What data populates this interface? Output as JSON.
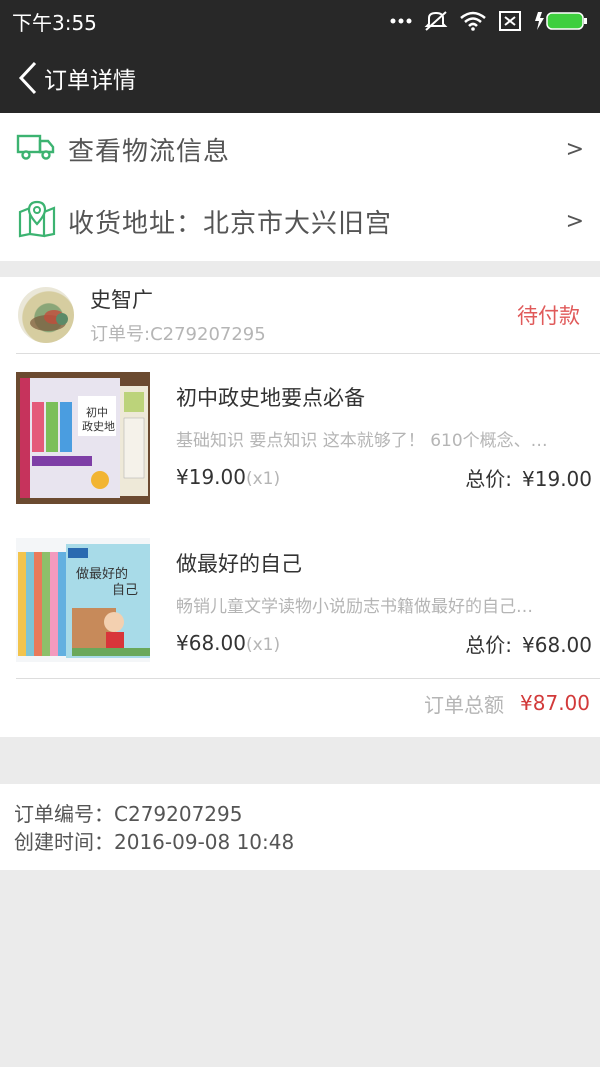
{
  "status_bar": {
    "time": "下午3:55"
  },
  "nav": {
    "title": "订单详情"
  },
  "links": {
    "logistics": "查看物流信息",
    "address": "收货地址：北京市大兴旧宫",
    "arrow": ">"
  },
  "order": {
    "shop_name": "史智广",
    "order_no_label": "订单号:C279207295",
    "status": "待付款",
    "products": [
      {
        "name": "初中政史地要点必备",
        "desc": "基础知识 要点知识 这本就够了！ 610个概念、…",
        "price": "¥19.00",
        "qty": "(x1)",
        "total_label": "总价:",
        "total": "¥19.00"
      },
      {
        "name": "做最好的自己",
        "desc": "畅销儿童文学读物小说励志书籍做最好的自己…",
        "price": "¥68.00",
        "qty": "(x1)",
        "total_label": "总价:",
        "total": "¥68.00"
      }
    ],
    "sum_label": "订单总额",
    "sum_value": "¥87.00"
  },
  "meta": {
    "order_number": "订单编号：C279207295",
    "created_time": "创建时间：2016-09-08 10:48"
  },
  "colors": {
    "accent_green": "#3cb371",
    "status_red": "#e05a5a",
    "price_red": "#d23a3a"
  },
  "icons": {
    "truck": "truck-icon",
    "map": "map-pin-icon",
    "back": "back-arrow-icon"
  }
}
